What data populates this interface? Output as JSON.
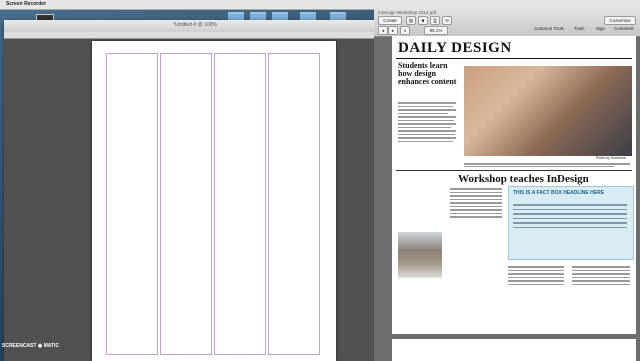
{
  "menubar": {
    "app_name": "Screen Recorder"
  },
  "indesign": {
    "title": "*Untitled-9 @ 100%"
  },
  "acrobat": {
    "toolbar": {
      "create_label": "Create",
      "zoom_value": "95.1%",
      "page_value": "1",
      "customize_label": "Customize",
      "tools_label": "Tools",
      "sign_label": "Sign",
      "comment_label": "Comment",
      "common_tools_label": "Common Tools"
    },
    "file_title": "InDesign Workshop 2014.pdf"
  },
  "newsletter": {
    "masthead": "DAILY DESIGN",
    "headline1": "Students learn how design enhances content",
    "headline2": "Workshop teaches InDesign",
    "factbox_title": "THIS IS A FACT BOX HEADLINE HERE",
    "photo_credit": "Photo by Someone"
  },
  "footer": {
    "watermark": "SCREENCAST ◉ MATIC"
  }
}
